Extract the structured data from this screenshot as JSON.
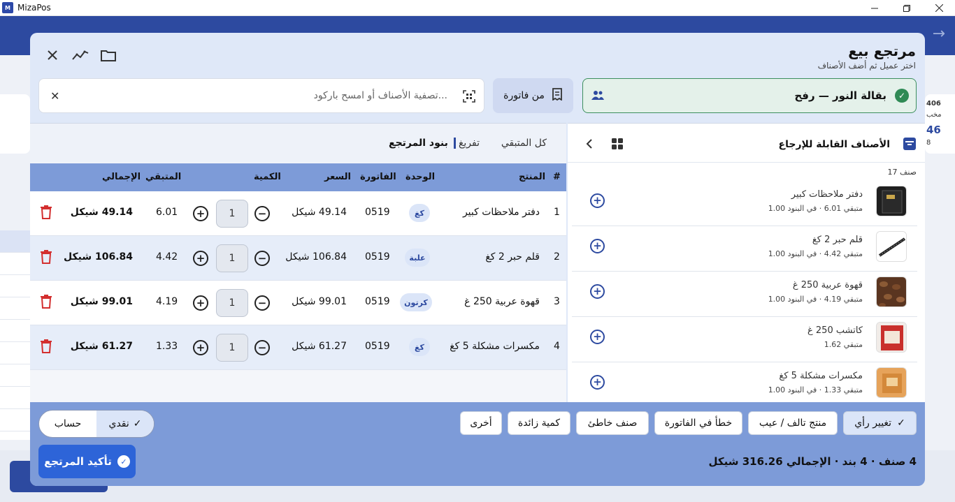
{
  "app": {
    "title": "MizaPos",
    "icon_text": "M"
  },
  "background": {
    "right_card_lines": [
      "406",
      "مخب",
      "46",
      "8"
    ]
  },
  "modal": {
    "title": "مرتجع بيع",
    "subtitle": "اختر عميل ثم أضف الأصناف",
    "customer_name": "بقالة النور — رفح",
    "from_invoice_label": "من فاتورة",
    "search_placeholder": "تصفية الأصناف أو امسح باركود..."
  },
  "tabs": [
    "كل المتبقي",
    "تفريغ",
    "بنود المرتجع"
  ],
  "table": {
    "headers": {
      "num": "#",
      "product": "المنتج",
      "unit": "الوحدة",
      "invoice": "الفاتورة",
      "price": "السعر",
      "qty": "الكمية",
      "remaining": "المتبقي",
      "total": "الإجمالي"
    },
    "rows": [
      {
        "num": "1",
        "product": "دفتر ملاحظات كبير",
        "unit": "كغ",
        "invoice": "0519",
        "price": "49.14 شيكل",
        "qty": "1",
        "remaining": "6.01",
        "total": "49.14 شيكل"
      },
      {
        "num": "2",
        "product": "قلم حبر 2 كغ",
        "unit": "علبة",
        "invoice": "0519",
        "price": "106.84 شيكل",
        "qty": "1",
        "remaining": "4.42",
        "total": "106.84 شيكل"
      },
      {
        "num": "3",
        "product": "قهوة عربية 250 غ",
        "unit": "كرتون",
        "invoice": "0519",
        "price": "99.01 شيكل",
        "qty": "1",
        "remaining": "4.19",
        "total": "99.01 شيكل"
      },
      {
        "num": "4",
        "product": "مكسرات مشكلة 5 كغ",
        "unit": "كغ",
        "invoice": "0519",
        "price": "61.27 شيكل",
        "qty": "1",
        "remaining": "1.33",
        "total": "61.27 شيكل"
      }
    ]
  },
  "returnable": {
    "title": "الأصناف القابلة للإرجاع",
    "count": "17 صنف",
    "items": [
      {
        "name": "دفتر ملاحظات كبير",
        "sub": "متبقي 6.01 · في البنود 1.00",
        "thumb": "notebook"
      },
      {
        "name": "قلم حبر 2 كغ",
        "sub": "متبقي 4.42 · في البنود 1.00",
        "thumb": "pen"
      },
      {
        "name": "قهوة عربية 250 غ",
        "sub": "متبقي 4.19 · في البنود 1.00",
        "thumb": "coffee"
      },
      {
        "name": "كاتشب 250 غ",
        "sub": "متبقي 1.62",
        "thumb": "ketchup"
      },
      {
        "name": "مكسرات مشكلة 5 كغ",
        "sub": "متبقي 1.33 · في البنود 1.00",
        "thumb": "nuts"
      }
    ]
  },
  "reasons": [
    "تغيير رأي",
    "منتج تالف / عيب",
    "خطأ في الفاتورة",
    "صنف خاطئ",
    "كمية زائدة",
    "أخرى"
  ],
  "reason_selected": "تغيير رأي",
  "payment": {
    "cash": "نقدي",
    "account": "حساب",
    "selected": "نقدي"
  },
  "confirm_label": "تأكيد المرتجع",
  "summary": "4 صنف · 4 بند · الإجمالي 316.26 شيكل",
  "colors": {
    "primary": "#2d4aa0",
    "accent": "#2d64d8",
    "success": "#2f8a55",
    "danger": "#d32f2f"
  }
}
